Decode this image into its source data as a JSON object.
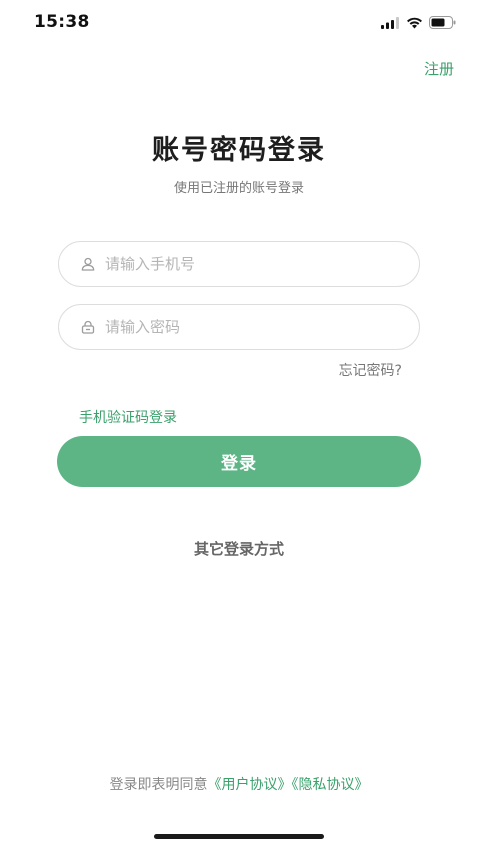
{
  "status_bar": {
    "time": "15:38"
  },
  "header": {
    "register_label": "注册"
  },
  "main": {
    "title": "账号密码登录",
    "subtitle": "使用已注册的账号登录",
    "phone_placeholder": "请输入手机号",
    "password_placeholder": "请输入密码",
    "forgot_label": "忘记密码?",
    "sms_login_label": "手机验证码登录",
    "login_button_label": "登录",
    "other_login_label": "其它登录方式"
  },
  "footer": {
    "agreement_prefix": "登录即表明同意",
    "user_agreement_label": "《用户协议》",
    "privacy_agreement_label": "《隐私协议》"
  },
  "colors": {
    "accent": "#3aa16b",
    "button": "#5db586"
  },
  "icons": {
    "phone_field_icon": "user-icon",
    "password_field_icon": "lock-icon"
  }
}
